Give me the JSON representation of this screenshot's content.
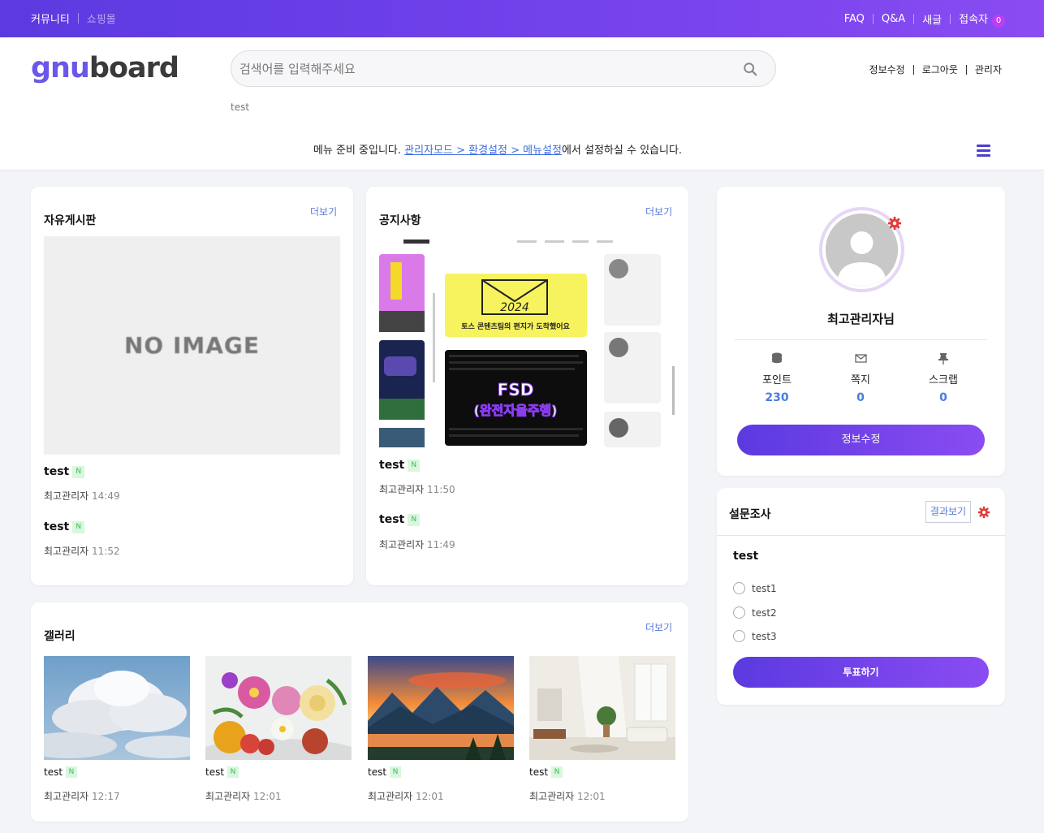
{
  "topbar": {
    "community": "커뮤니티",
    "shop": "쇼핑몰",
    "faq": "FAQ",
    "qa": "Q&A",
    "new_posts": "새글",
    "visitors_label": "접속자",
    "visitors_count": "0"
  },
  "header": {
    "logo_part1": "gnu",
    "logo_part2": "board",
    "search_placeholder": "검색어를 입력해주세요",
    "popular_keyword": "test",
    "links": [
      "정보수정",
      "로그아웃",
      "관리자"
    ],
    "menu_msg_prefix": "메뉴 준비 중입니다. ",
    "menu_msg_link": "관리자모드 > 환경설정 > 메뉴설정",
    "menu_msg_suffix": "에서 설정하실 수 있습니다."
  },
  "free_board": {
    "title": "자유게시판",
    "more": "더보기",
    "no_image": "NO IMAGE",
    "posts": [
      {
        "title": "test",
        "badge": "N",
        "author": "최고관리자",
        "time": "14:49"
      },
      {
        "title": "test",
        "badge": "N",
        "author": "최고관리자",
        "time": "11:52"
      }
    ]
  },
  "notice": {
    "title": "공지사항",
    "more": "더보기",
    "thumb_text1": "2024",
    "thumb_text2": "토스 콘텐츠팀의 편지가 도착했어요",
    "thumb_text3": "FSD",
    "thumb_text4": "(완전자율주행)",
    "posts": [
      {
        "title": "test",
        "badge": "N",
        "author": "최고관리자",
        "time": "11:50"
      },
      {
        "title": "test",
        "badge": "N",
        "author": "최고관리자",
        "time": "11:49"
      }
    ]
  },
  "gallery": {
    "title": "갤러리",
    "more": "더보기",
    "items": [
      {
        "title": "test",
        "badge": "N",
        "author": "최고관리자",
        "time": "12:17",
        "image": "clouds"
      },
      {
        "title": "test",
        "badge": "N",
        "author": "최고관리자",
        "time": "12:01",
        "image": "flowers"
      },
      {
        "title": "test",
        "badge": "N",
        "author": "최고관리자",
        "time": "12:01",
        "image": "lake-sunset"
      },
      {
        "title": "test",
        "badge": "N",
        "author": "최고관리자",
        "time": "12:01",
        "image": "interior"
      }
    ]
  },
  "profile": {
    "name": "최고관리자님",
    "stats": [
      {
        "label": "포인트",
        "value": "230",
        "icon": "coins-icon"
      },
      {
        "label": "쪽지",
        "value": "0",
        "icon": "envelope-icon"
      },
      {
        "label": "스크랩",
        "value": "0",
        "icon": "pin-icon"
      }
    ],
    "edit_button": "정보수정"
  },
  "poll": {
    "title": "설문조사",
    "results_button": "결과보기",
    "question": "test",
    "options": [
      "test1",
      "test2",
      "test3"
    ],
    "vote_button": "투표하기"
  },
  "colors": {
    "accent": "#6a44ea",
    "link": "#3c6ee0",
    "more": "#5b7bd8",
    "badge_bg": "#d8f7de",
    "badge_fg": "#3bbd57"
  }
}
